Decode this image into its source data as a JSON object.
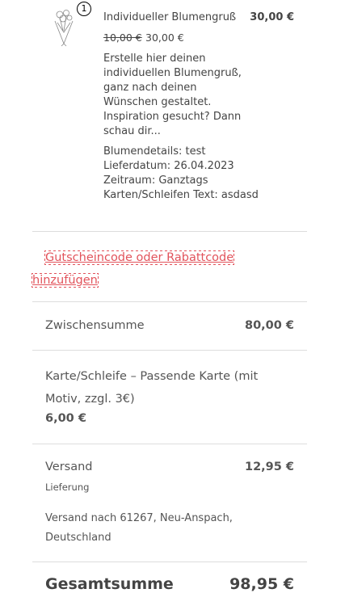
{
  "item": {
    "quantity": "1",
    "name": "Individueller Blumengruß",
    "line_total": "30,00 €",
    "old_price": "10,00 €",
    "new_price": "30,00 €",
    "description": "Erstelle hier deinen individuellen Blumengruß, ganz nach deinen Wünschen gestaltet. Inspiration gesucht? Dann schau dir...",
    "details": [
      "Blumendetails: test",
      "Lieferdatum: 26.04.2023",
      "Zeitraum: Ganztags",
      "Karten/Schleifen Text: asdasd"
    ],
    "thumbnail_icon": "flower-bouquet-icon"
  },
  "coupon": {
    "label": "Gutscheincode oder Rabattcode hinzufügen"
  },
  "subtotal": {
    "label": "Zwischensumme",
    "value": "80,00 €"
  },
  "fee": {
    "label": "Karte/Schleife – Passende Karte (mit Motiv, zzgl. 3€)",
    "value": "6,00 €"
  },
  "shipping": {
    "label": "Versand",
    "value": "12,95 €",
    "method": "Lieferung",
    "destination": "Versand nach 61267, Neu-Anspach, Deutschland"
  },
  "total": {
    "label": "Gesamtsumme",
    "value": "98,95 €"
  },
  "colors": {
    "link": "#e2535b",
    "text": "#444444",
    "divider": "#dddddd"
  }
}
